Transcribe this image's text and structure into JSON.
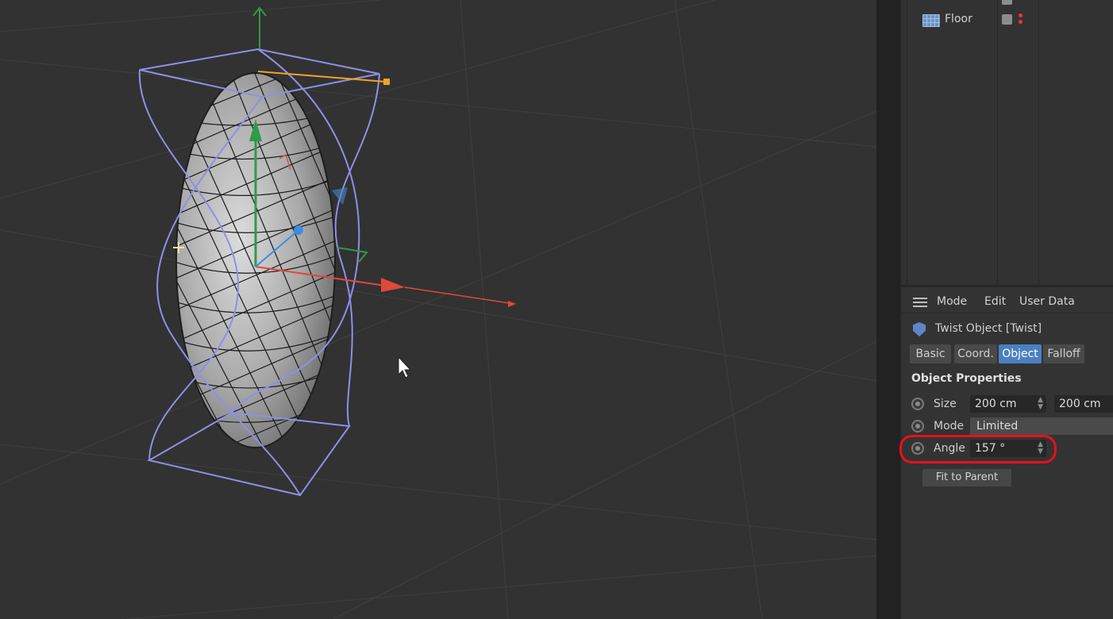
{
  "object_manager": {
    "objects": [
      {
        "name": "Floor",
        "icon": "floor-icon"
      }
    ]
  },
  "attributes": {
    "menu": [
      "Mode",
      "Edit",
      "User Data"
    ],
    "object_title": "Twist Object [Twist]",
    "tabs": [
      {
        "label": "Basic",
        "active": false
      },
      {
        "label": "Coord.",
        "active": false
      },
      {
        "label": "Object",
        "active": true
      },
      {
        "label": "Falloff",
        "active": false
      }
    ],
    "section_title": "Object Properties",
    "size": {
      "label": "Size",
      "x": "200 cm",
      "y": "200 cm"
    },
    "mode": {
      "label": "Mode",
      "value": "Limited"
    },
    "angle": {
      "label": "Angle",
      "value": "157 °"
    },
    "fit_button": "Fit to Parent"
  },
  "colors": {
    "accent_tab": "#4b7fc1",
    "highlight_annotation": "#e8101c",
    "deformer_cage": "#8f8fe8",
    "axis_x": "#e0483a",
    "axis_y": "#2f9a4a",
    "axis_z": "#3b8ee0"
  }
}
